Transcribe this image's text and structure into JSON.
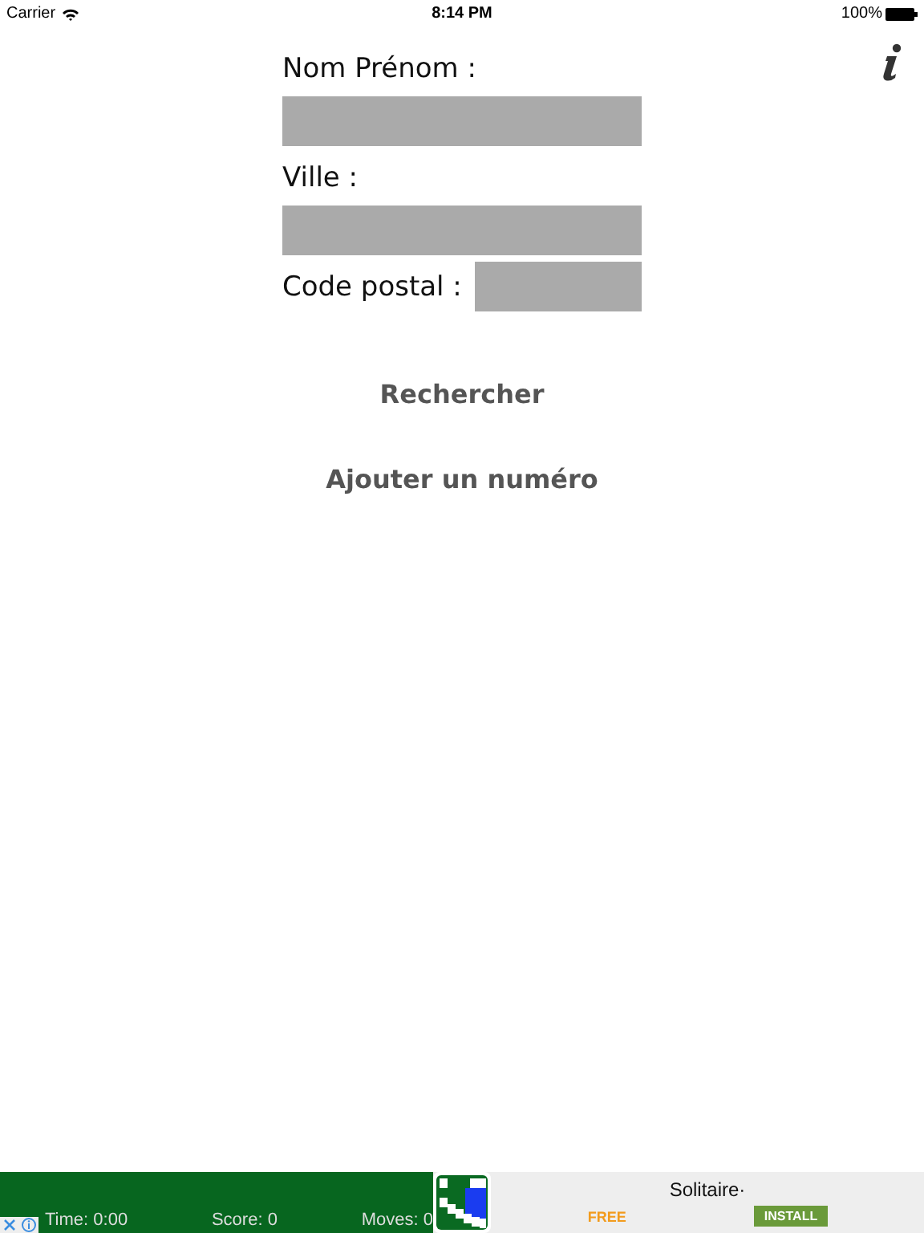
{
  "status_bar": {
    "carrier": "Carrier",
    "time": "8:14 PM",
    "battery": "100%"
  },
  "form": {
    "fields": [
      {
        "label": "Nom Prénom :",
        "kind": "full"
      },
      {
        "label": "Ville :",
        "kind": "full"
      },
      {
        "label": "Code postal :",
        "kind": "inline"
      }
    ],
    "buttons": [
      "Rechercher",
      "Ajouter un numéro"
    ]
  },
  "ad": {
    "stats": [
      "Time: 0:00",
      "Score: 0",
      "Moves: 0"
    ],
    "title": "Solitaire·",
    "price": "FREE",
    "install": "INSTALL"
  }
}
